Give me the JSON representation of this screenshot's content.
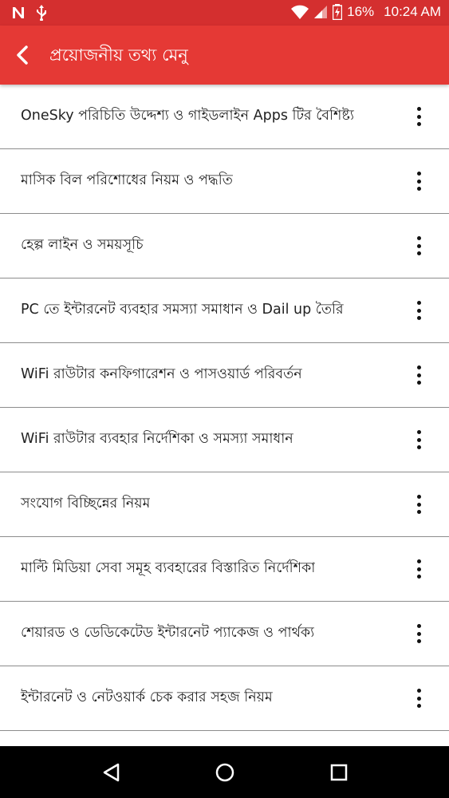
{
  "status_bar": {
    "battery_percent": "16%",
    "time": "10:24 AM"
  },
  "app_bar": {
    "title": "প্রয়োজনীয় তথ্য মেনু"
  },
  "menu_items": [
    {
      "label": "OneSky পরিচিতি  উদ্দেশ্য ও গাইডলাইন Apps টির বৈশিষ্ট্য"
    },
    {
      "label": "মাসিক বিল পরিশোধের নিয়ম ও পদ্ধতি"
    },
    {
      "label": "হেল্প লাইন ও সময়সূচি"
    },
    {
      "label": "PC তে ইন্টারনেট ব্যবহার সমস্যা সমাধান ও Dail up তৈরি"
    },
    {
      "label": "WiFi রাউটার কনফিগারেশন ও পাসওয়ার্ড পরিবর্তন"
    },
    {
      "label": "WiFi রাউটার ব্যবহার নির্দেশিকা ও সমস্যা সমাধান"
    },
    {
      "label": "সংযোগ বিচ্ছিন্নের নিয়ম"
    },
    {
      "label": " মাল্টি মিডিয়া সেবা সমূহ ব্যবহারের বিস্তারিত নির্দেশিকা"
    },
    {
      "label": "শেয়ারড ও ডেডিকেটেড ইন্টারনেট প্যাকেজ ও পার্থক্য"
    },
    {
      "label": "ইন্টারনেট ও নেটওয়ার্ক চেক করার সহজ নিয়ম"
    }
  ],
  "colors": {
    "status_bar": "#d42f2f",
    "app_bar": "#e53935",
    "divider": "#8c8c8c",
    "nav_bar": "#000000"
  },
  "icons": [
    "n-notification-icon",
    "usb-icon",
    "wifi-icon",
    "cell-signal-icon",
    "battery-icon",
    "back-arrow-icon",
    "more-vert-icon",
    "nav-back-icon",
    "nav-home-icon",
    "nav-recents-icon"
  ]
}
